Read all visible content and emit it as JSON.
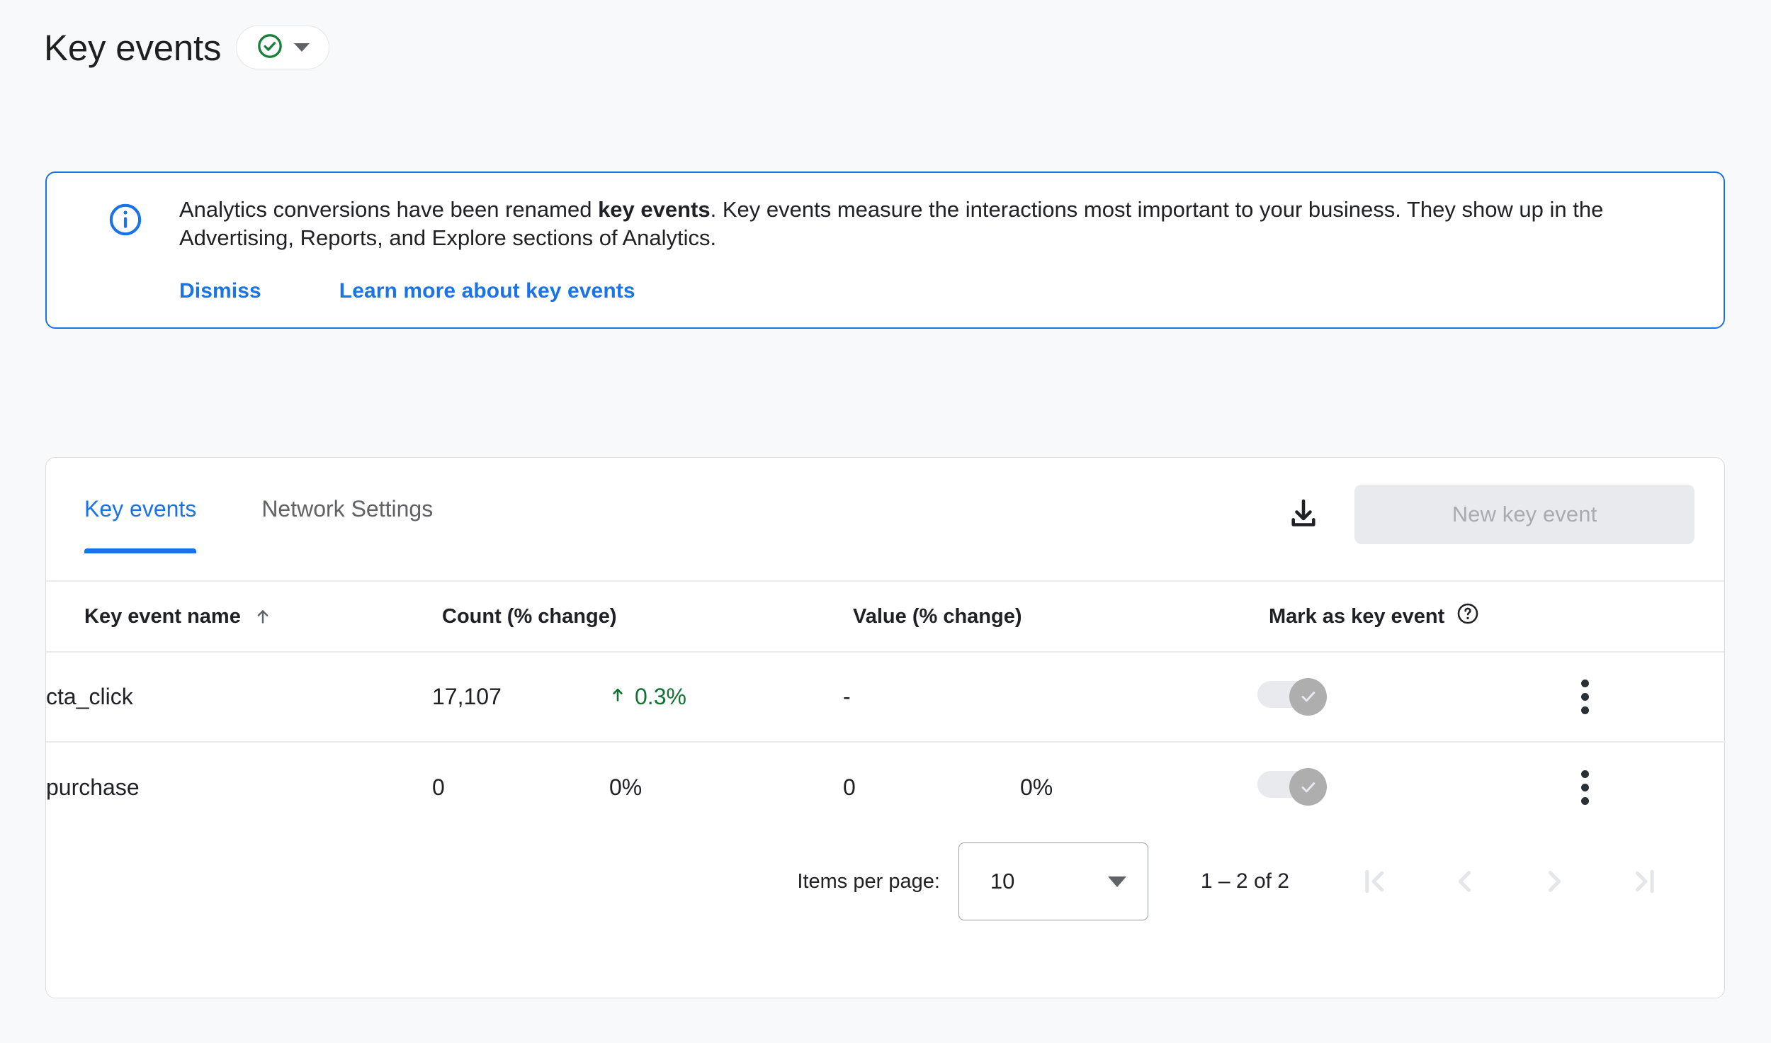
{
  "header": {
    "title": "Key events",
    "status_chip": {
      "icon": "check-circle-icon",
      "caret": "chevron-down-icon",
      "color": "#188038"
    }
  },
  "banner": {
    "icon": "info-icon",
    "accent_color": "#1a73e8",
    "text_part1": "Analytics conversions have been renamed ",
    "text_bold": "key events",
    "text_part2": ". Key events measure the interactions most important to your business. They show up in the Advertising, Reports, and Explore sections of Analytics.",
    "dismiss_label": "Dismiss",
    "learn_more_label": "Learn more about key events"
  },
  "card": {
    "tabs": [
      {
        "label": "Key events",
        "active": true
      },
      {
        "label": "Network Settings",
        "active": false
      }
    ],
    "download_icon": "download-icon",
    "new_key_event_label": "New key event",
    "table": {
      "columns": [
        {
          "label": "Key event name",
          "sort": "ascending-arrow-icon"
        },
        {
          "label": "Count (% change)"
        },
        {
          "label": "Value (% change)"
        },
        {
          "label": "Mark as key event",
          "help": "help-icon"
        }
      ],
      "rows": [
        {
          "name": "cta_click",
          "count": "17,107",
          "count_change": "0.3%",
          "count_change_direction": "up",
          "count_change_color": "#137333",
          "value": "-",
          "value_change": "",
          "marked": true,
          "menu": "more-vert-icon"
        },
        {
          "name": "purchase",
          "count": "0",
          "count_change": "0%",
          "count_change_direction": "none",
          "count_change_color": "#202124",
          "value": "0",
          "value_change": "0%",
          "marked": true,
          "menu": "more-vert-icon"
        }
      ]
    },
    "paginator": {
      "items_per_page_label": "Items per page:",
      "items_per_page_value": "10",
      "range_label": "1 – 2 of 2",
      "first_page_icon": "first-page-icon",
      "prev_page_icon": "chevron-left-icon",
      "next_page_icon": "chevron-right-icon",
      "last_page_icon": "last-page-icon"
    }
  }
}
